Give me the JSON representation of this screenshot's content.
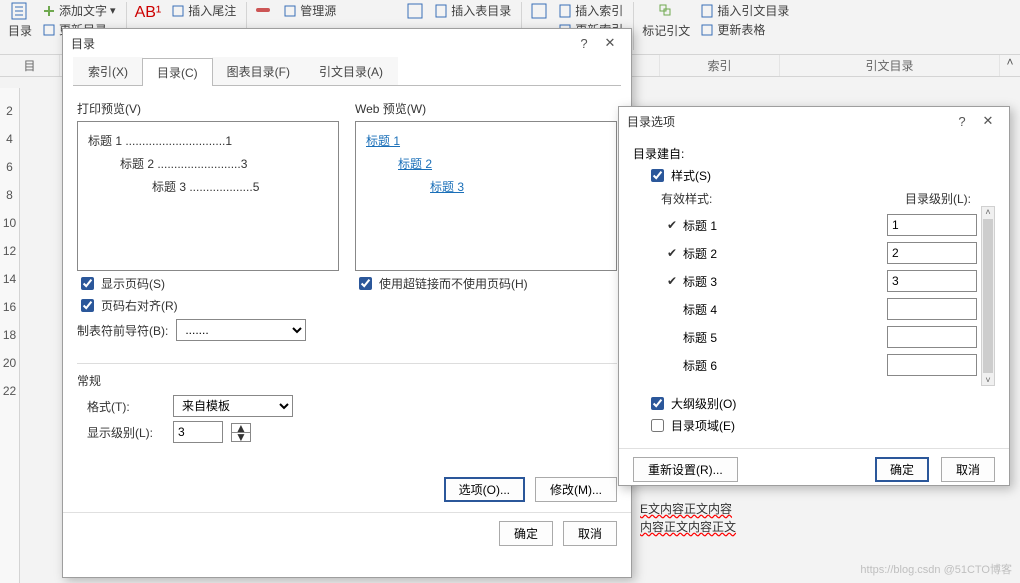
{
  "ribbon": {
    "mulu": "目录",
    "add_text": "添加文字",
    "update_mulu": "更新目录",
    "ab": "AB¹",
    "insert_endnote": "插入尾注",
    "manage_source": "管理源",
    "insert_toc_tbl": "插入表目录",
    "insert_index": "插入索引",
    "update_index": "更新索引",
    "mark_cite": "标记引文",
    "insert_cite_toc": "插入引文目录",
    "update_table": "更新表格",
    "group_index": "索引",
    "group_cite": "引文目录"
  },
  "toc_dialog": {
    "title": "目录",
    "tabs": {
      "index": "索引(X)",
      "toc": "目录(C)",
      "fig": "图表目录(F)",
      "cite": "引文目录(A)"
    },
    "print_preview_lbl": "打印预览(V)",
    "web_preview_lbl": "Web 预览(W)",
    "print_lines": {
      "l1": "标题 1 ..............................1",
      "l2": "标题 2 .........................3",
      "l3": "标题 3 ...................5"
    },
    "web_lines": {
      "l1": "标题 1",
      "l2": "标题 2",
      "l3": "标题 3"
    },
    "show_pagenum": "显示页码(S)",
    "right_align": "页码右对齐(R)",
    "leader_lbl": "制表符前导符(B):",
    "leader_val": ".......",
    "use_hyperlink": "使用超链接而不使用页码(H)",
    "general": "常规",
    "format_lbl": "格式(T):",
    "format_val": "来自模板",
    "levels_lbl": "显示级别(L):",
    "levels_val": "3",
    "options_btn": "选项(O)...",
    "modify_btn": "修改(M)...",
    "ok": "确定",
    "cancel": "取消"
  },
  "opt_dialog": {
    "title": "目录选项",
    "build_from": "目录建自:",
    "styles_chk": "样式(S)",
    "valid_styles": "有效样式:",
    "toc_level": "目录级别(L):",
    "rows": [
      {
        "chk": "✔",
        "name": "标题 1",
        "val": "1"
      },
      {
        "chk": "✔",
        "name": "标题 2",
        "val": "2"
      },
      {
        "chk": "✔",
        "name": "标题 3",
        "val": "3"
      },
      {
        "chk": "",
        "name": "标题 4",
        "val": ""
      },
      {
        "chk": "",
        "name": "标题 5",
        "val": ""
      },
      {
        "chk": "",
        "name": "标题 6",
        "val": ""
      }
    ],
    "outline_chk": "大纲级别(O)",
    "field_chk": "目录项域(E)",
    "reset_btn": "重新设置(R)...",
    "ok": "确定",
    "cancel": "取消"
  },
  "leaked": {
    "a": "E文内容正文内容",
    "b": "内容正文内容正文"
  },
  "ruler": [
    "2",
    "4",
    "6",
    "8",
    "10",
    "12",
    "14",
    "16",
    "18",
    "20",
    "22"
  ],
  "watermark": "https://blog.csdn @51CTO博客"
}
